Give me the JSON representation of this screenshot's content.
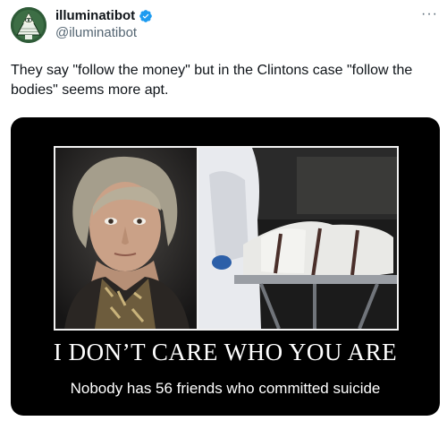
{
  "user": {
    "display_name": "illuminatibot",
    "handle": "@iluminatibot",
    "verified": true,
    "verified_color": "#1d9bf0"
  },
  "menu": {
    "more_label": "···"
  },
  "tweet": {
    "text": "They say \"follow the money\" but in the Clintons case \"follow the bodies\" seems more apt."
  },
  "media": {
    "caption_title": "I DON’T CARE WHO YOU ARE",
    "caption_subtitle": "Nobody has 56 friends who committed suicide",
    "background_color": "#000000"
  }
}
